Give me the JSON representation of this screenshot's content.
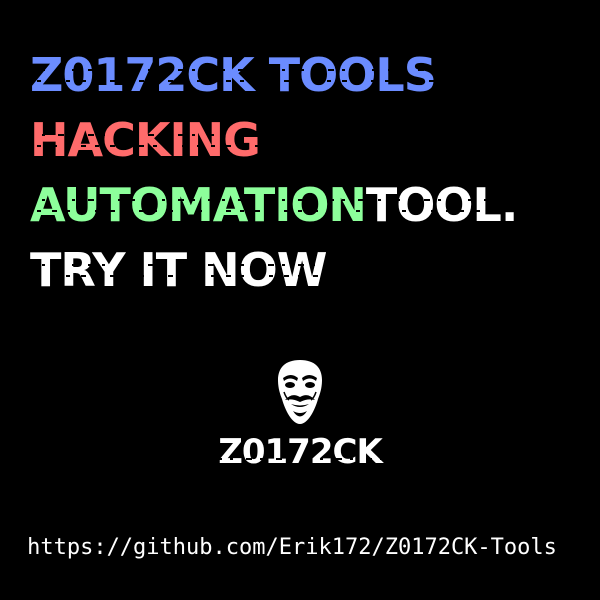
{
  "headline": {
    "line1": {
      "text": "Z0172CK TOOLS",
      "color": "#6b8cff"
    },
    "line2": {
      "text": "HACKING",
      "color": "#ff6b6b"
    },
    "line3": {
      "part1": "AUTOMATION",
      "part1_color": "#8dff9b",
      "part2": " TOOL.",
      "part2_color": "#ffffff"
    },
    "line4": {
      "text": "TRY IT NOW",
      "color": "#ffffff"
    }
  },
  "logo": {
    "icon": "mask-icon",
    "name": "Z0172CK"
  },
  "url": "https://github.com/Erik172/Z0172CK-Tools",
  "background": "#000000"
}
